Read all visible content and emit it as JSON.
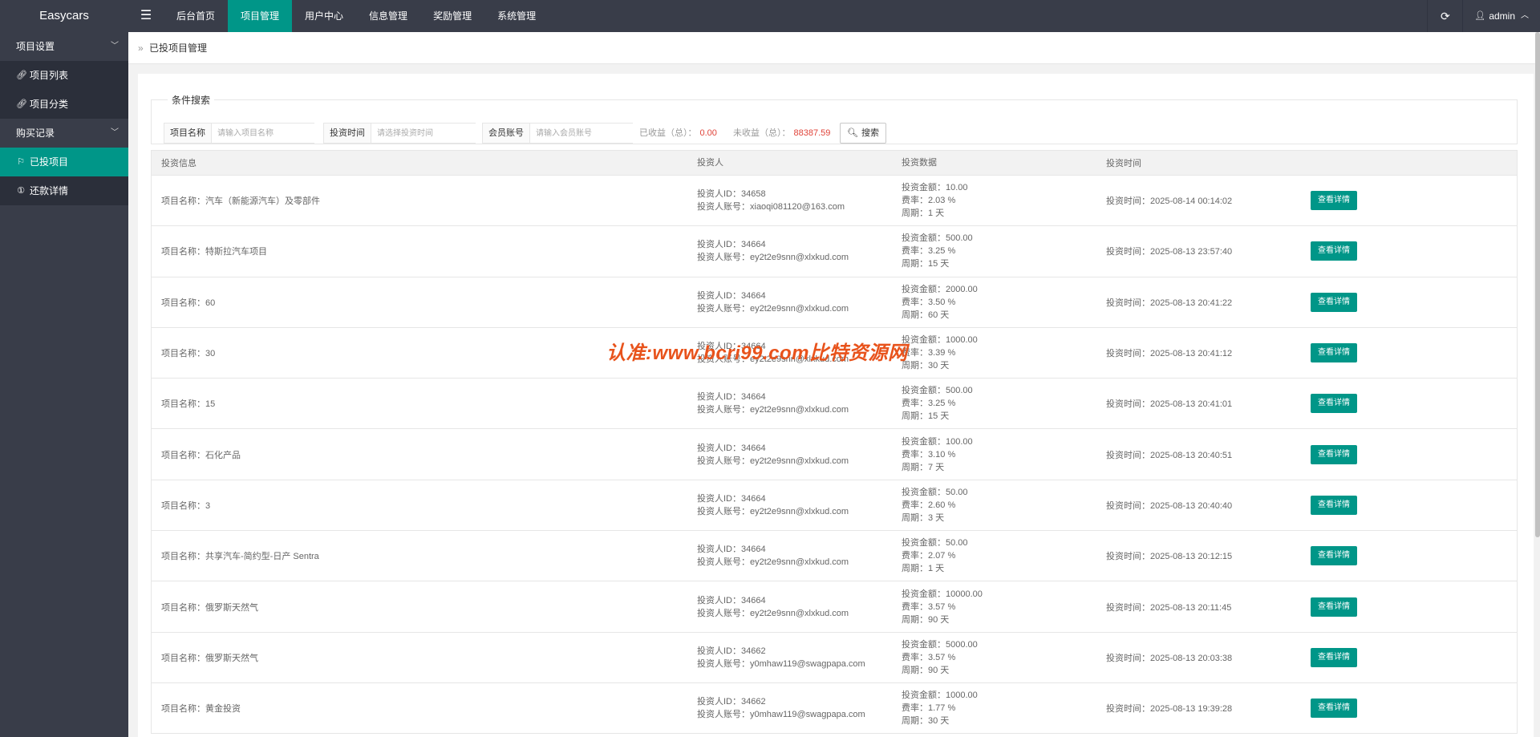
{
  "header": {
    "logo": "Easycars",
    "menu_icon": "hamburger-icon",
    "nav": [
      {
        "label": "后台首页",
        "active": false
      },
      {
        "label": "项目管理",
        "active": true
      },
      {
        "label": "用户中心",
        "active": false
      },
      {
        "label": "信息管理",
        "active": false
      },
      {
        "label": "奖励管理",
        "active": false
      },
      {
        "label": "系统管理",
        "active": false
      }
    ],
    "user": "admin"
  },
  "sidebar": {
    "groups": [
      {
        "label": "项目设置",
        "items": [
          {
            "label": "项目列表",
            "icon": "link-icon",
            "active": false
          },
          {
            "label": "项目分类",
            "icon": "link-icon",
            "active": false
          }
        ]
      },
      {
        "label": "购买记录",
        "items": [
          {
            "label": "已投项目",
            "icon": "flag-icon",
            "active": true
          },
          {
            "label": "还款详情",
            "icon": "coin-icon",
            "active": false
          }
        ]
      }
    ]
  },
  "breadcrumb": {
    "sep": "»",
    "current": "已投项目管理"
  },
  "search": {
    "legend": "条件搜索",
    "name_label": "项目名称",
    "name_placeholder": "请输入项目名称",
    "time_label": "投资时间",
    "time_placeholder": "请选择投资时间",
    "account_label": "会员账号",
    "account_placeholder": "请输入会员账号",
    "earned_label": "已收益（总）：",
    "earned_value": "0.00",
    "unearned_label": "未收益（总）：",
    "unearned_value": "88387.59",
    "button": "搜索"
  },
  "table": {
    "headers": [
      "投资信息",
      "投资人",
      "投资数据",
      "投资时间"
    ],
    "button_label": "查看详情",
    "rows": [
      {
        "name": "项目名称：汽车（新能源汽车）及零部件",
        "uid": "投资人ID：34658",
        "account": "投资人账号：xiaoqi081120@163.com",
        "amount": "投资金额：10.00",
        "rate": "费率：2.03 %",
        "period": "周期：1 天",
        "time": "投资时间：2025-08-14 00:14:02"
      },
      {
        "name": "项目名称：特斯拉汽车项目",
        "uid": "投资人ID：34664",
        "account": "投资人账号：ey2t2e9snn@xlxkud.com",
        "amount": "投资金额：500.00",
        "rate": "费率：3.25 %",
        "period": "周期：15 天",
        "time": "投资时间：2025-08-13 23:57:40"
      },
      {
        "name": "项目名称：60",
        "uid": "投资人ID：34664",
        "account": "投资人账号：ey2t2e9snn@xlxkud.com",
        "amount": "投资金额：2000.00",
        "rate": "费率：3.50 %",
        "period": "周期：60 天",
        "time": "投资时间：2025-08-13 20:41:22"
      },
      {
        "name": "项目名称：30",
        "uid": "投资人ID：34664",
        "account": "投资人账号：ey2t2e9snn@xlxkud.com",
        "amount": "投资金额：1000.00",
        "rate": "费率：3.39 %",
        "period": "周期：30 天",
        "time": "投资时间：2025-08-13 20:41:12"
      },
      {
        "name": "项目名称：15",
        "uid": "投资人ID：34664",
        "account": "投资人账号：ey2t2e9snn@xlxkud.com",
        "amount": "投资金额：500.00",
        "rate": "费率：3.25 %",
        "period": "周期：15 天",
        "time": "投资时间：2025-08-13 20:41:01"
      },
      {
        "name": "项目名称：石化产品",
        "uid": "投资人ID：34664",
        "account": "投资人账号：ey2t2e9snn@xlxkud.com",
        "amount": "投资金额：100.00",
        "rate": "费率：3.10 %",
        "period": "周期：7 天",
        "time": "投资时间：2025-08-13 20:40:51"
      },
      {
        "name": "项目名称：3",
        "uid": "投资人ID：34664",
        "account": "投资人账号：ey2t2e9snn@xlxkud.com",
        "amount": "投资金额：50.00",
        "rate": "费率：2.60 %",
        "period": "周期：3 天",
        "time": "投资时间：2025-08-13 20:40:40"
      },
      {
        "name": "项目名称：共享汽车-简约型-日产 Sentra",
        "uid": "投资人ID：34664",
        "account": "投资人账号：ey2t2e9snn@xlxkud.com",
        "amount": "投资金额：50.00",
        "rate": "费率：2.07 %",
        "period": "周期：1 天",
        "time": "投资时间：2025-08-13 20:12:15"
      },
      {
        "name": "项目名称：俄罗斯天然气",
        "uid": "投资人ID：34664",
        "account": "投资人账号：ey2t2e9snn@xlxkud.com",
        "amount": "投资金额：10000.00",
        "rate": "费率：3.57 %",
        "period": "周期：90 天",
        "time": "投资时间：2025-08-13 20:11:45"
      },
      {
        "name": "项目名称：俄罗斯天然气",
        "uid": "投资人ID：34662",
        "account": "投资人账号：y0mhaw119@swagpapa.com",
        "amount": "投资金额：5000.00",
        "rate": "费率：3.57 %",
        "period": "周期：90 天",
        "time": "投资时间：2025-08-13 20:03:38"
      },
      {
        "name": "项目名称：黄金投资",
        "uid": "投资人ID：34662",
        "account": "投资人账号：y0mhaw119@swagpapa.com",
        "amount": "投资金额：1000.00",
        "rate": "费率：1.77 %",
        "period": "周期：30 天",
        "time": "投资时间：2025-08-13 19:39:28"
      }
    ]
  },
  "watermark": "认准:www.bcri99.com比特资源网",
  "colors": {
    "header_bg": "#393d49",
    "accent": "#009688",
    "value_red": "#e0443a",
    "watermark": "#e8531c"
  }
}
